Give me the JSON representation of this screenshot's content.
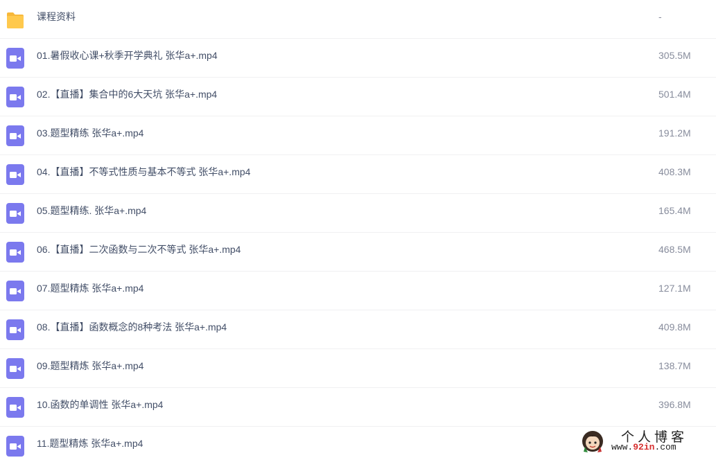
{
  "files": [
    {
      "type": "folder",
      "icon": "folder-icon",
      "name": "课程资料",
      "size": "-"
    },
    {
      "type": "video",
      "icon": "video-file-icon",
      "name": "01.暑假收心课+秋季开学典礼 张华a+.mp4",
      "size": "305.5M"
    },
    {
      "type": "video",
      "icon": "video-file-icon",
      "name": "02.【直播】集合中的6大天坑 张华a+.mp4",
      "size": "501.4M"
    },
    {
      "type": "video",
      "icon": "video-file-icon",
      "name": "03.题型精练 张华a+.mp4",
      "size": "191.2M"
    },
    {
      "type": "video",
      "icon": "video-file-icon",
      "name": "04.【直播】不等式性质与基本不等式 张华a+.mp4",
      "size": "408.3M"
    },
    {
      "type": "video",
      "icon": "video-file-icon",
      "name": "05.题型精练. 张华a+.mp4",
      "size": "165.4M"
    },
    {
      "type": "video",
      "icon": "video-file-icon",
      "name": "06.【直播】二次函数与二次不等式 张华a+.mp4",
      "size": "468.5M"
    },
    {
      "type": "video",
      "icon": "video-file-icon",
      "name": "07.题型精炼 张华a+.mp4",
      "size": "127.1M"
    },
    {
      "type": "video",
      "icon": "video-file-icon",
      "name": "08.【直播】函数概念的8种考法 张华a+.mp4",
      "size": "409.8M"
    },
    {
      "type": "video",
      "icon": "video-file-icon",
      "name": "09.题型精炼 张华a+.mp4",
      "size": "138.7M"
    },
    {
      "type": "video",
      "icon": "video-file-icon",
      "name": "10.函数的单调性 张华a+.mp4",
      "size": "396.8M"
    },
    {
      "type": "video",
      "icon": "video-file-icon",
      "name": "11.题型精炼 张华a+.mp4",
      "size": ""
    }
  ],
  "watermark": {
    "title": "个人博客",
    "url_prefix": "www.",
    "url_accent": "92in",
    "url_suffix": ".com"
  },
  "colors": {
    "folder": "#ffc94d",
    "folder_tab": "#f7b83a",
    "video": "#7b79ee",
    "name_text": "#424e67",
    "size_text": "#878c9c",
    "divider": "#f0f0f2",
    "watermark_accent": "#d62f2f"
  }
}
